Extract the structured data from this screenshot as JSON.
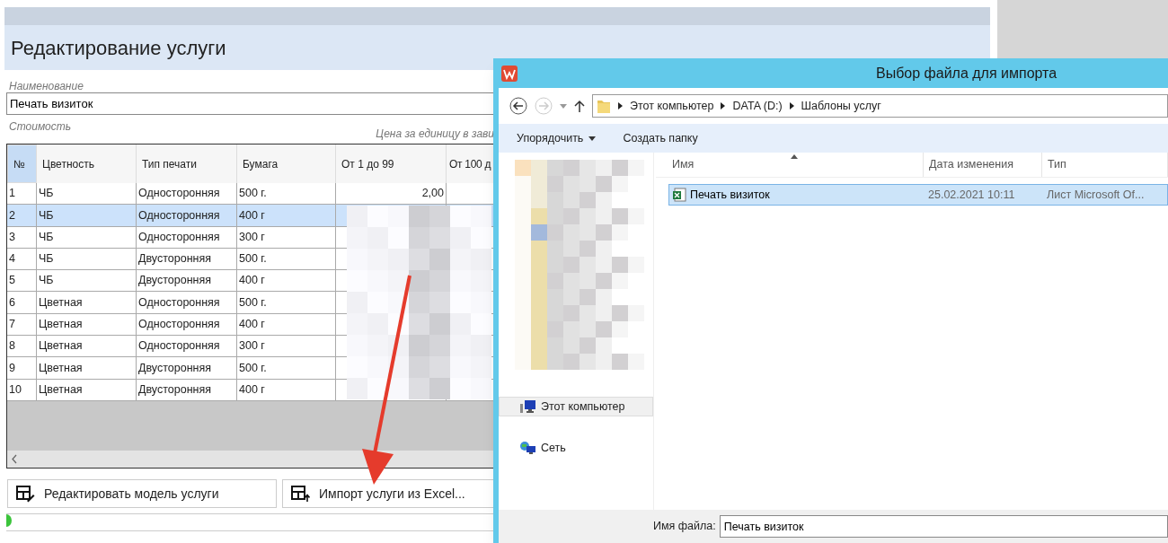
{
  "main_window": {
    "heading": "Редактирование услуги",
    "name_field": {
      "label": "Наименование",
      "value": "Печать визиток"
    },
    "cost_label": "Стоимость",
    "price_note": "Цена за единицу в зави",
    "table": {
      "columns": [
        "№",
        "Цветность",
        "Тип печати",
        "Бумага",
        "От 1 до 99",
        "От 100 д"
      ],
      "rows": [
        {
          "cells": [
            "1",
            "ЧБ",
            "Односторонняя",
            "500 г."
          ],
          "price": "2,00",
          "selected": false
        },
        {
          "cells": [
            "2",
            "ЧБ",
            "Односторонняя",
            "400 г"
          ],
          "selected": true
        },
        {
          "cells": [
            "3",
            "ЧБ",
            "Односторонняя",
            "300 г"
          ],
          "selected": false
        },
        {
          "cells": [
            "4",
            "ЧБ",
            "Двусторонняя",
            "500 г."
          ],
          "selected": false
        },
        {
          "cells": [
            "5",
            "ЧБ",
            "Двусторонняя",
            "400 г"
          ],
          "selected": false
        },
        {
          "cells": [
            "6",
            "Цветная",
            "Односторонняя",
            "500 г."
          ],
          "selected": false
        },
        {
          "cells": [
            "7",
            "Цветная",
            "Односторонняя",
            "400 г"
          ],
          "selected": false
        },
        {
          "cells": [
            "8",
            "Цветная",
            "Односторонняя",
            "300 г"
          ],
          "selected": false
        },
        {
          "cells": [
            "9",
            "Цветная",
            "Двусторонняя",
            "500 г."
          ],
          "selected": false
        },
        {
          "cells": [
            "10",
            "Цветная",
            "Двусторонняя",
            "400 г"
          ],
          "selected": false
        }
      ]
    },
    "buttons": [
      {
        "kind": "edit",
        "label": "Редактировать модель услуги"
      },
      {
        "kind": "import",
        "label": "Импорт услуги из Excel..."
      }
    ]
  },
  "dialog": {
    "title": "Выбор файла для импорта",
    "path": [
      "Этот компьютер",
      "DATA (D:)",
      "Шаблоны услуг"
    ],
    "toolbar": [
      {
        "label": "Упорядочить",
        "dropdown": true
      },
      {
        "label": "Создать папку",
        "dropdown": false
      }
    ],
    "nav": [
      {
        "kind": "computer",
        "label": "Этот компьютер",
        "selected": true
      },
      {
        "kind": "network",
        "label": "Сеть",
        "selected": false
      }
    ],
    "columns": [
      "Имя",
      "Дата изменения",
      "Тип"
    ],
    "files": [
      {
        "name": "Печать визиток",
        "date": "25.02.2021 10:11",
        "type": "Лист Microsoft Of...",
        "selected": true
      }
    ],
    "file_name": {
      "label": "Имя файла:",
      "value": "Печать визиток"
    }
  }
}
